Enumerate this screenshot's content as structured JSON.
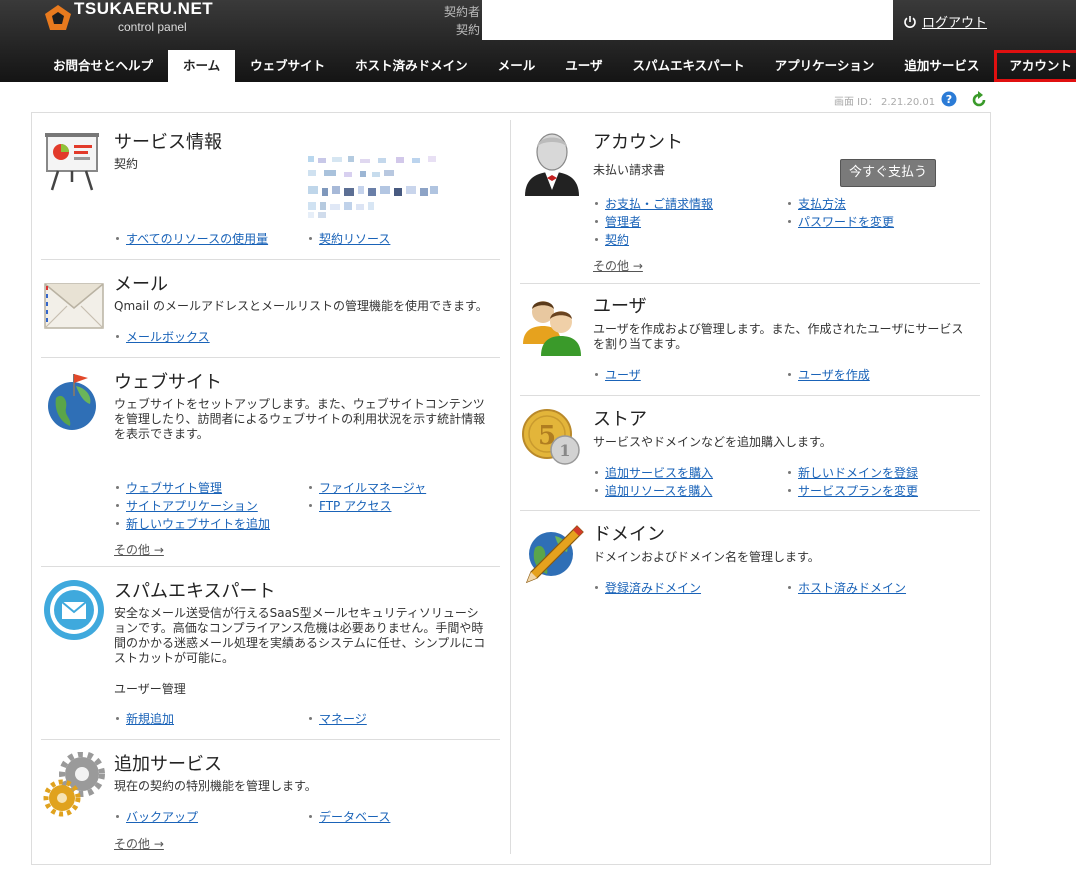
{
  "header": {
    "logo_text": "TSUKAERU.NET",
    "logo_sub": "control panel",
    "contract_holder_label": "契約者",
    "contract_label": "契約",
    "logout": "ログアウト"
  },
  "nav": {
    "tabs": [
      {
        "label": "お問合せとヘルプ"
      },
      {
        "label": "ホーム"
      },
      {
        "label": "ウェブサイト"
      },
      {
        "label": "ホスト済みドメイン"
      },
      {
        "label": "メール"
      },
      {
        "label": "ユーザ"
      },
      {
        "label": "スパムエキスパート"
      },
      {
        "label": "アプリケーション"
      },
      {
        "label": "追加サービス"
      },
      {
        "label": "アカウント"
      }
    ]
  },
  "screen_id": "画面 ID： 2.21.20.01",
  "more_label": "その他 →",
  "service_info": {
    "title": "サービス情報",
    "contract_label": "契約",
    "links": [
      "すべてのリソースの使用量",
      "契約リソース"
    ]
  },
  "mail": {
    "title": "メール",
    "desc": "Qmail のメールアドレスとメールリストの管理機能を使用できます。",
    "links": [
      "メールボックス"
    ]
  },
  "website": {
    "title": "ウェブサイト",
    "desc": "ウェブサイトをセットアップします。また、ウェブサイトコンテンツを管理したり、訪問者によるウェブサイトの利用状況を示す統計情報を表示できます。",
    "links": [
      "ウェブサイト管理",
      "ファイルマネージャ",
      "サイトアプリケーション",
      "FTP アクセス",
      "新しいウェブサイトを追加"
    ]
  },
  "spam": {
    "title": "スパムエキスパート",
    "desc": "安全なメール送受信が行えるSaaS型メールセキュリティソリューションです。高価なコンプライアンス危機は必要ありません。手間や時間のかかる迷惑メール処理を実績あるシステムに任せ、シンプルにコストカットが可能に。",
    "sub": "ユーザー管理",
    "links": [
      "新規追加",
      "マネージ"
    ]
  },
  "addons": {
    "title": "追加サービス",
    "desc": "現在の契約の特別機能を管理します。",
    "links": [
      "バックアップ",
      "データベース"
    ]
  },
  "account": {
    "title": "アカウント",
    "unpaid": "未払い請求書",
    "pay_button": "今すぐ支払う",
    "links": [
      "お支払・ご請求情報",
      "支払方法",
      "管理者",
      "パスワードを変更",
      "契約"
    ]
  },
  "users": {
    "title": "ユーザ",
    "desc": "ユーザを作成および管理します。また、作成されたユーザにサービスを割り当てます。",
    "links": [
      "ユーザ",
      "ユーザを作成"
    ]
  },
  "store": {
    "title": "ストア",
    "desc": "サービスやドメインなどを追加購入します。",
    "links": [
      "追加サービスを購入",
      "新しいドメインを登録",
      "追加リソースを購入",
      "サービスプランを変更"
    ]
  },
  "domains": {
    "title": "ドメイン",
    "desc": "ドメインおよびドメイン名を管理します。",
    "links": [
      "登録済みドメイン",
      "ホスト済みドメイン"
    ]
  },
  "colors": {
    "header_bg": "#1e1e1e",
    "link": "#1a63b8",
    "highlight_border": "#e01010"
  }
}
